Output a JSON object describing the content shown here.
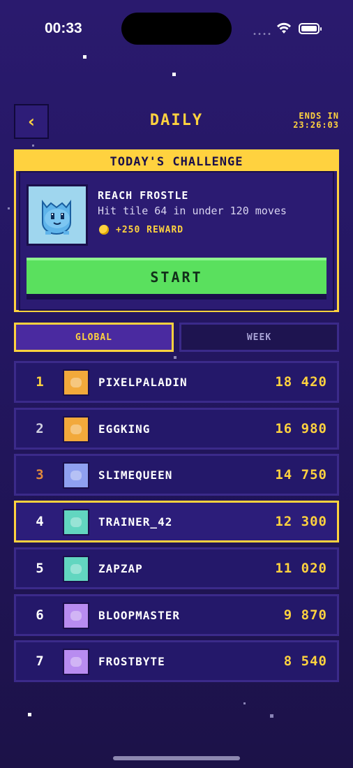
{
  "status": {
    "time": "00:33"
  },
  "header": {
    "back_icon": "chevron-left-icon",
    "title": "DAILY",
    "ends_label": "ENDS IN",
    "ends_time": "23:26:03"
  },
  "challenge": {
    "heading": "TODAY'S CHALLENGE",
    "name": "REACH FROSTLE",
    "description": "Hit tile 64 in under 120 moves",
    "reward": "+250 REWARD",
    "start_label": "START"
  },
  "tabs": [
    {
      "label": "GLOBAL",
      "active": true
    },
    {
      "label": "WEEK",
      "active": false
    }
  ],
  "leaderboard": [
    {
      "rank": "1",
      "name": "PIXELPALADIN",
      "score": "18 420",
      "avatar_color": "#f2a93b",
      "rank_color": "#ffd23f"
    },
    {
      "rank": "2",
      "name": "EGGKING",
      "score": "16 980",
      "avatar_color": "#f2a93b",
      "rank_color": "#d0d0e0"
    },
    {
      "rank": "3",
      "name": "SLIMEQUEEN",
      "score": "14 750",
      "avatar_color": "#8fa0f0",
      "rank_color": "#e08a3c"
    },
    {
      "rank": "4",
      "name": "TRAINER_42",
      "score": "12 300",
      "avatar_color": "#62d6c0",
      "rank_color": "#ffffff",
      "is_me": true
    },
    {
      "rank": "5",
      "name": "ZAPZAP",
      "score": "11 020",
      "avatar_color": "#62d6c0",
      "rank_color": "#ffffff"
    },
    {
      "rank": "6",
      "name": "BLOOPMASTER",
      "score": "9 870",
      "avatar_color": "#b88cf0",
      "rank_color": "#ffffff"
    },
    {
      "rank": "7",
      "name": "FROSTBYTE",
      "score": "8 540",
      "avatar_color": "#b88cf0",
      "rank_color": "#ffffff"
    }
  ]
}
